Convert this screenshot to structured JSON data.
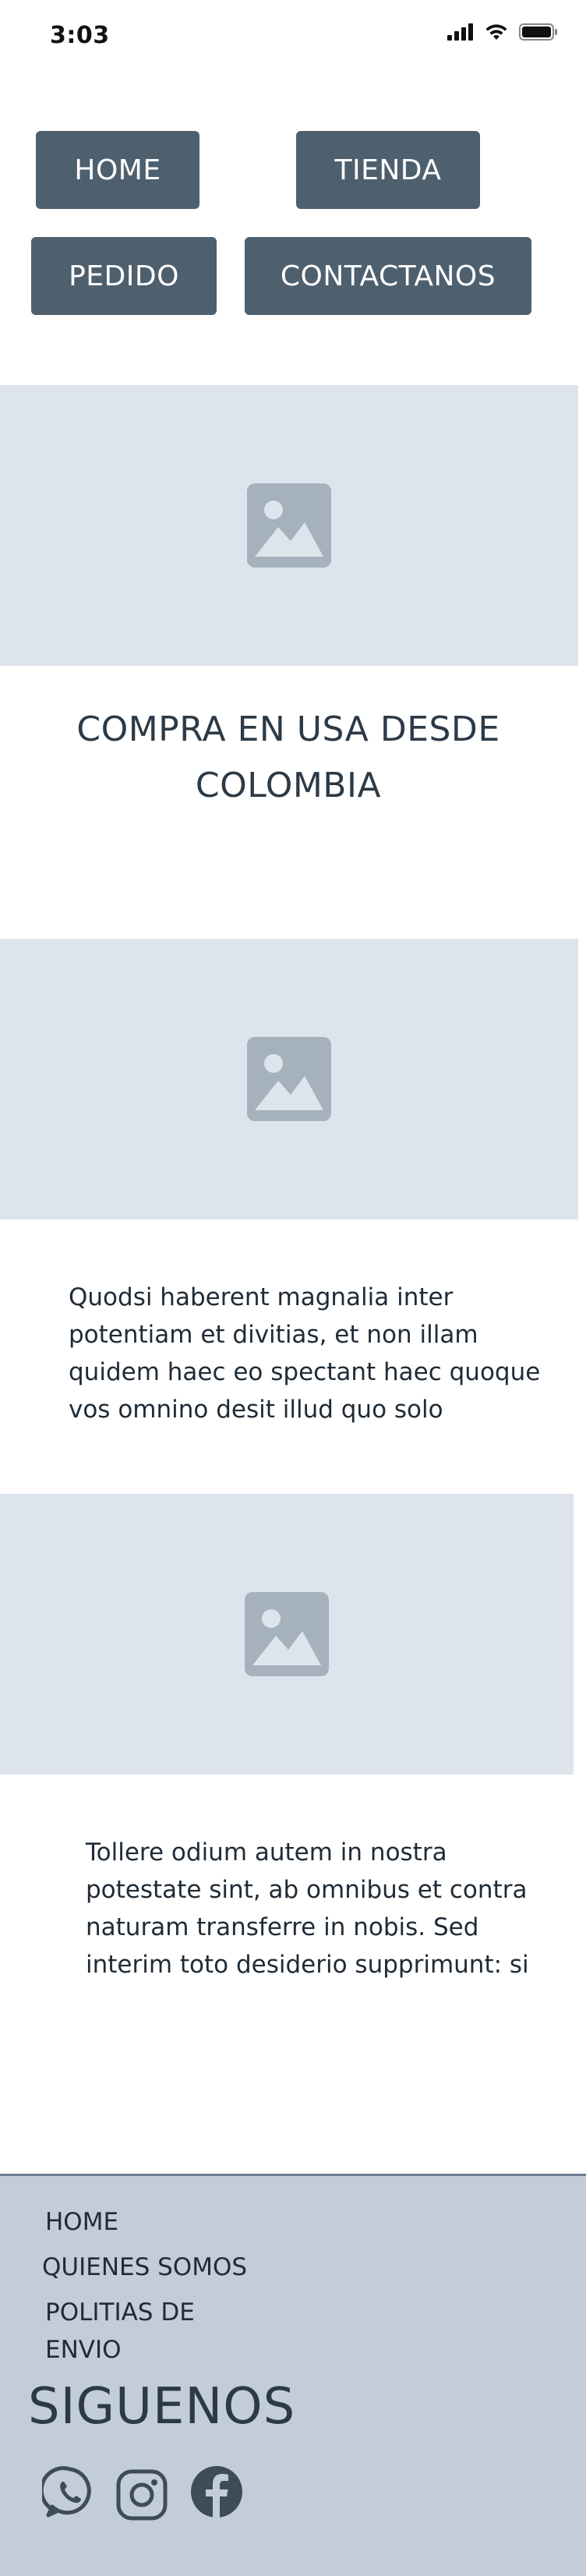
{
  "status_bar": {
    "time": "3:03",
    "icons": [
      "signal-icon",
      "wifi-icon",
      "battery-icon"
    ]
  },
  "nav": {
    "home": "HOME",
    "tienda": "TIENDA",
    "pedido": "PEDIDO",
    "contactanos": "CONTACTANOS"
  },
  "sections": {
    "headline": "COMPRA EN USA DESDE COLOMBIA",
    "paragraph_1": "Quodsi haberent magnalia inter potentiam et divitias, et non illam quidem haec eo spectant haec quoque vos omnino desit illud quo solo",
    "paragraph_2": "Tollere odium autem in nostra potestate sint, ab omnibus et contra naturam transferre in nobis. Sed interim toto desiderio supprimunt: si"
  },
  "footer": {
    "links": [
      "HOME",
      "QUIENES SOMOS",
      "POLITIAS DE ENVIO"
    ],
    "follow_title": "SIGUENOS",
    "social_icons": [
      "whatsapp-icon",
      "instagram-icon",
      "facebook-icon"
    ]
  },
  "colors": {
    "button_bg": "#4e5f6e",
    "placeholder_bg": "#dee4ec",
    "placeholder_icon": "#a5b1bd",
    "footer_bg": "#c3cdd7",
    "text": "#2c3a47"
  }
}
